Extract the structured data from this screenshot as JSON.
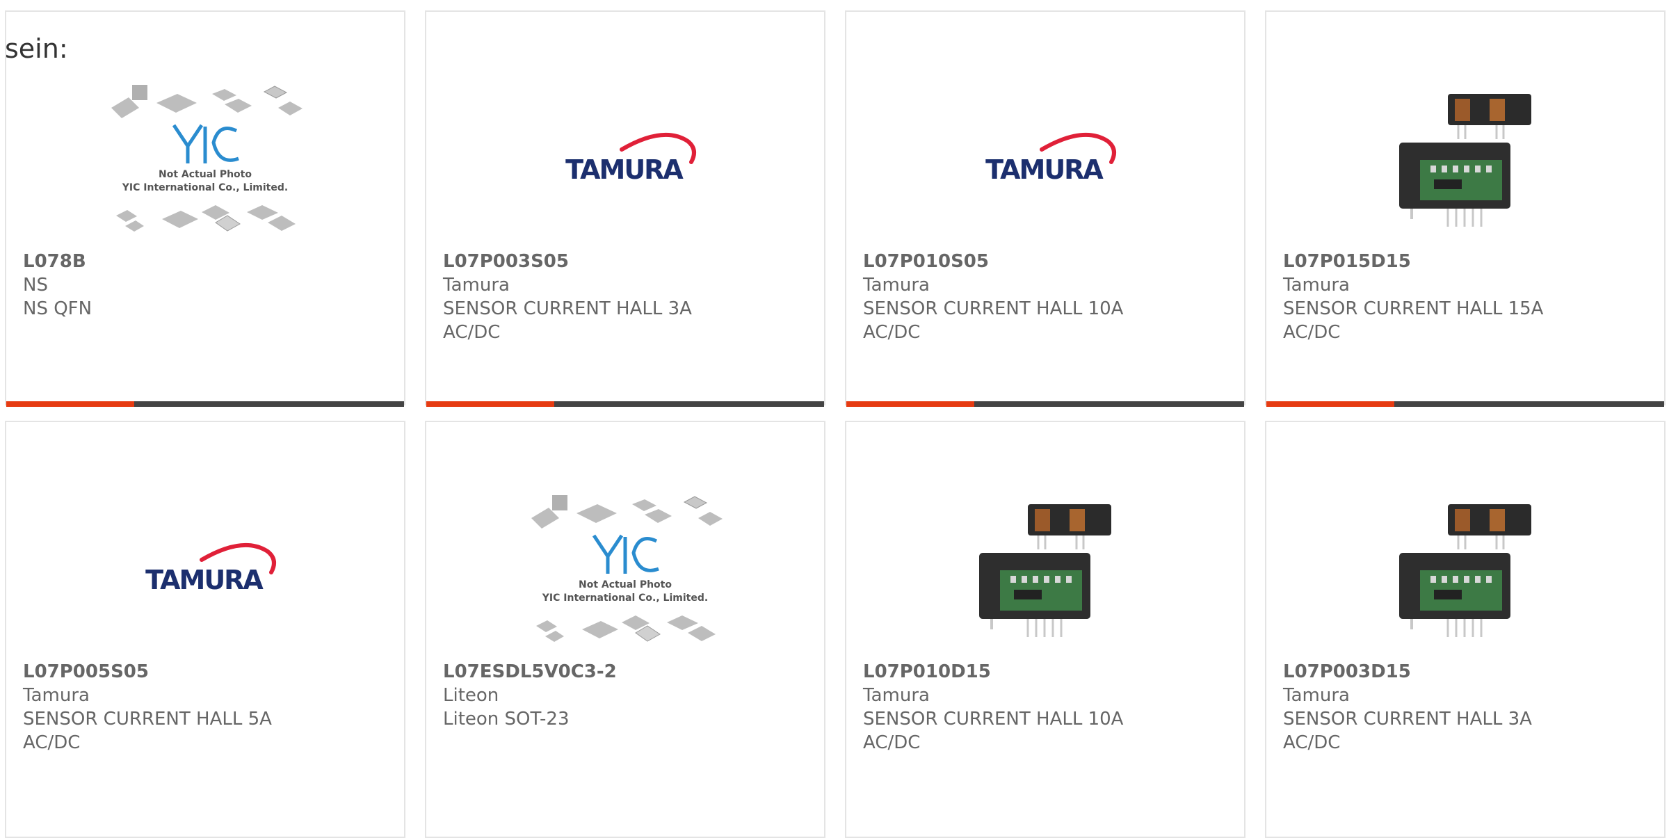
{
  "intro_text": "sein:",
  "colors": {
    "accent": "#e63b12",
    "bar": "#444444",
    "border": "#e4e4e4",
    "text": "#666666"
  },
  "products": [
    {
      "part": "L078B",
      "maker": "NS",
      "desc": "NS QFN",
      "desc2": "",
      "image": "yic-placeholder",
      "placeholder_l1": "Not Actual Photo",
      "placeholder_l2": "YIC International Co., Limited."
    },
    {
      "part": "L07P003S05",
      "maker": "Tamura",
      "desc": "SENSOR CURRENT HALL 3A",
      "desc2": "AC/DC",
      "image": "tamura-logo",
      "logo_text": "TAMURA"
    },
    {
      "part": "L07P010S05",
      "maker": "Tamura",
      "desc": "SENSOR CURRENT HALL 10A",
      "desc2": "AC/DC",
      "image": "tamura-logo",
      "logo_text": "TAMURA"
    },
    {
      "part": "L07P015D15",
      "maker": "Tamura",
      "desc": "SENSOR CURRENT HALL 15A",
      "desc2": "AC/DC",
      "image": "sensor-photo"
    },
    {
      "part": "L07P005S05",
      "maker": "Tamura",
      "desc": "SENSOR CURRENT HALL 5A",
      "desc2": "AC/DC",
      "image": "tamura-logo",
      "logo_text": "TAMURA"
    },
    {
      "part": "L07ESDL5V0C3-2",
      "maker": "Liteon",
      "desc": "Liteon SOT-23",
      "desc2": "",
      "image": "yic-placeholder",
      "placeholder_l1": "Not Actual Photo",
      "placeholder_l2": "YIC International Co., Limited."
    },
    {
      "part": "L07P010D15",
      "maker": "Tamura",
      "desc": "SENSOR CURRENT HALL 10A",
      "desc2": "AC/DC",
      "image": "sensor-photo"
    },
    {
      "part": "L07P003D15",
      "maker": "Tamura",
      "desc": "SENSOR CURRENT HALL 3A",
      "desc2": "AC/DC",
      "image": "sensor-photo"
    }
  ]
}
